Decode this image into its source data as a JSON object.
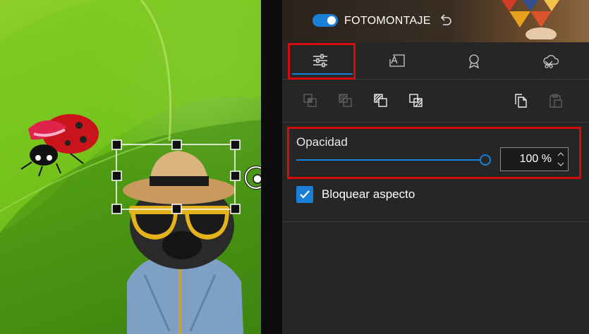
{
  "header": {
    "mode_label": "FOTOMONTAJE",
    "toggle_state": "on",
    "accent_color": "#1a7fd6",
    "highlight_color": "#d60b0b"
  },
  "tabs": [
    {
      "name": "adjust",
      "icon": "sliders-icon",
      "active": true
    },
    {
      "name": "text",
      "icon": "text-frame-icon",
      "active": false
    },
    {
      "name": "badge",
      "icon": "award-icon",
      "active": false
    },
    {
      "name": "shape",
      "icon": "cloud-scissors-icon",
      "active": false
    }
  ],
  "toolbar": {
    "tools": [
      {
        "icon": "bring-forward-icon",
        "enabled": false
      },
      {
        "icon": "send-backward-icon",
        "enabled": false
      },
      {
        "icon": "bring-to-front-icon",
        "enabled": true
      },
      {
        "icon": "send-to-back-icon",
        "enabled": true
      },
      {
        "icon": "copy-icon",
        "enabled": true
      },
      {
        "icon": "paste-icon",
        "enabled": false
      }
    ]
  },
  "opacity": {
    "label": "Opacidad",
    "value_text": "100 %",
    "value": 100
  },
  "lock_aspect": {
    "label": "Bloquear aspecto",
    "checked": true
  }
}
